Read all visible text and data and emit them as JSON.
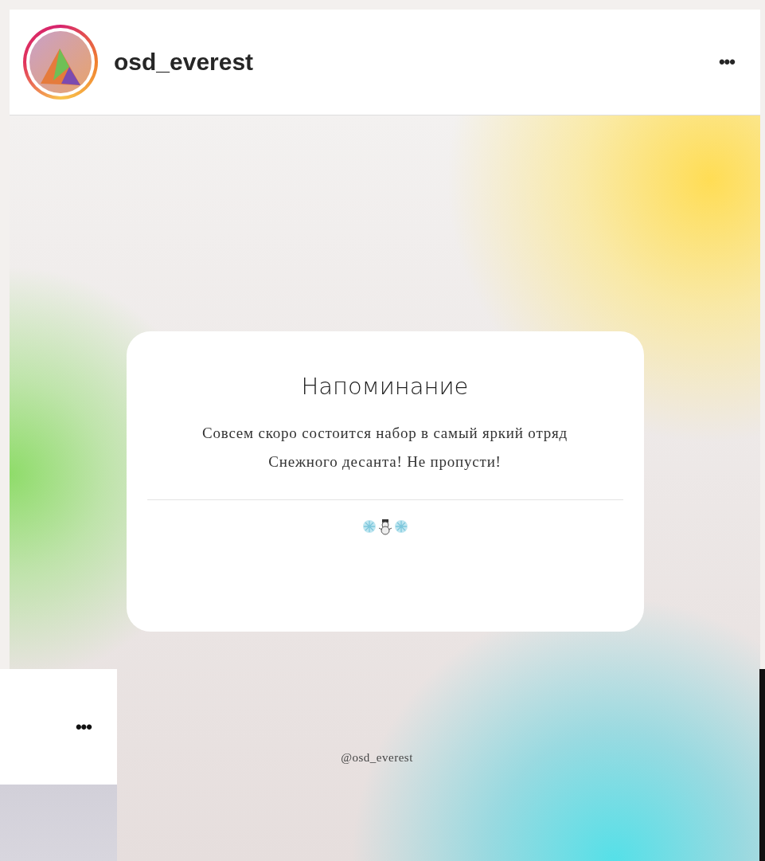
{
  "post": {
    "username": "osd_everest",
    "more": "•••"
  },
  "image": {
    "card": {
      "title": "Напоминание",
      "text": "Совсем скоро состоится набор в самый яркий отряд Снежного десанта! Не пропусти!"
    },
    "watermark": "@osd_everest"
  },
  "next_post": {
    "more": "•••"
  }
}
